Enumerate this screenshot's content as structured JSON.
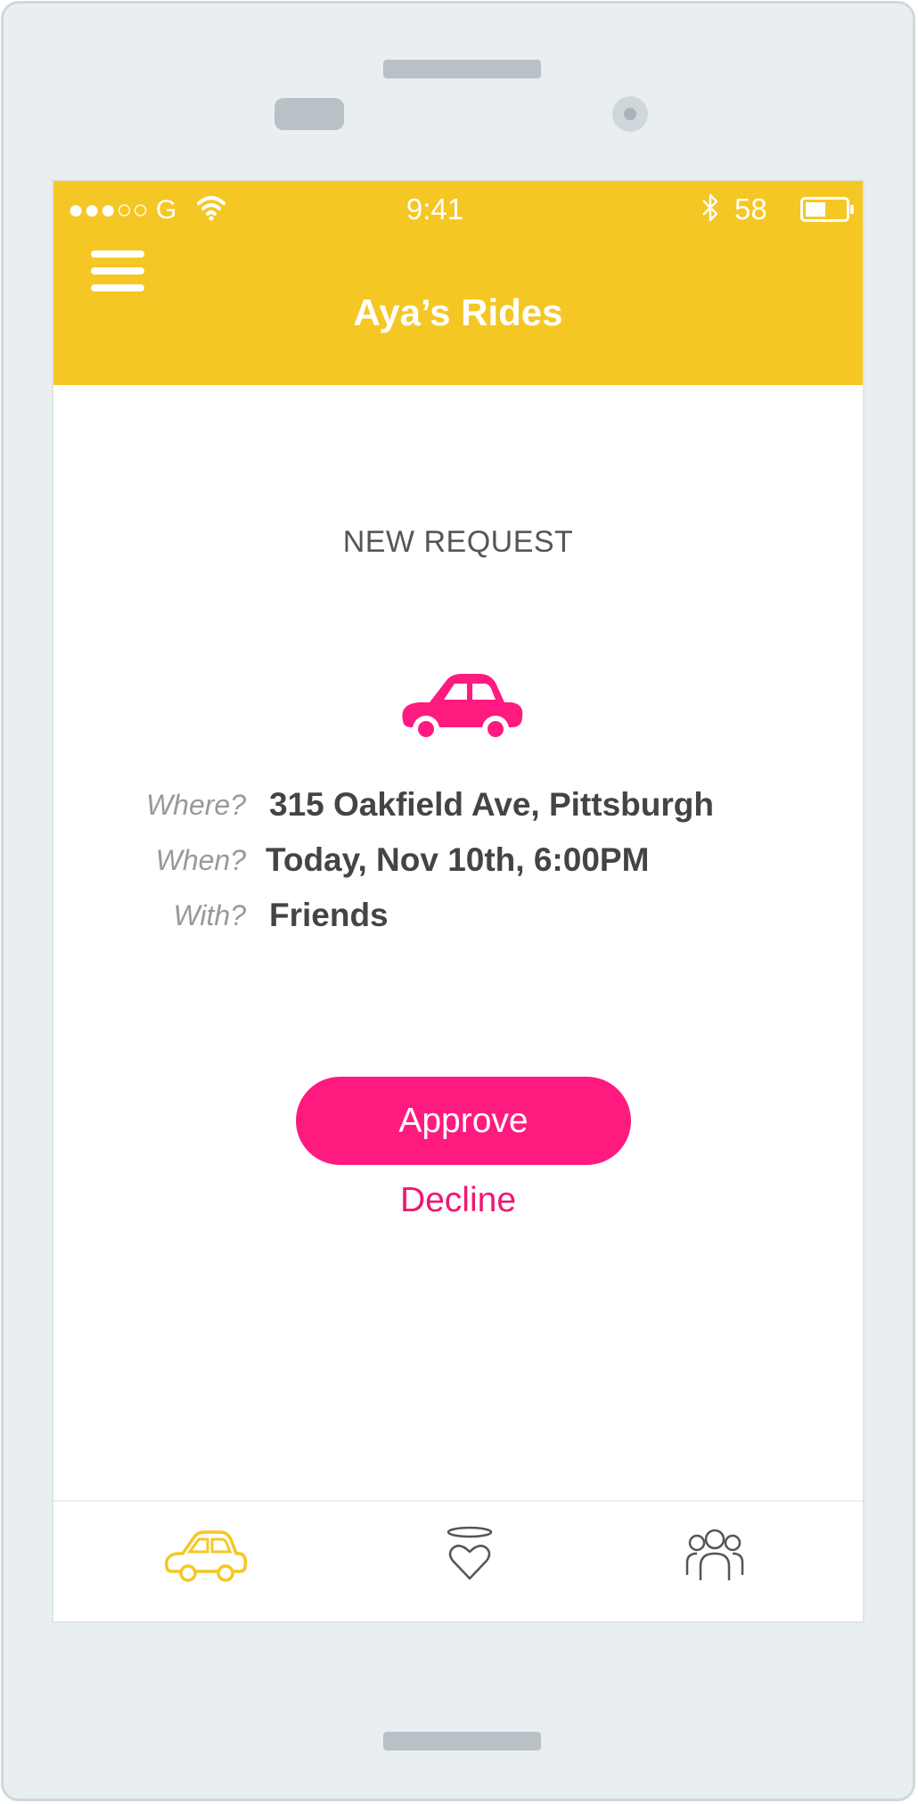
{
  "colors": {
    "accent": "#f5c724",
    "primary_pink": "#ff1a7f",
    "decline_pink": "#f01672",
    "text_dark": "#444444",
    "label_gray": "#999999",
    "tab_active": "#f5c724",
    "tab_inactive": "#555555"
  },
  "status_bar": {
    "signal": "●●●○○ G",
    "wifi_icon": "wifi-icon",
    "time": "9:41",
    "bluetooth_icon": "bluetooth-icon",
    "battery_percent": "58",
    "battery_icon": "battery-icon"
  },
  "header": {
    "menu_icon": "hamburger-menu-icon",
    "title": "Aya’s Rides"
  },
  "request": {
    "section_label": "NEW REQUEST",
    "hero_icon": "car-icon",
    "fields": [
      {
        "label": "Where?",
        "value": "315 Oakfield Ave, Pittsburgh"
      },
      {
        "label": "When?",
        "value": "Today, Nov 10th, 6:00PM"
      },
      {
        "label": "With?",
        "value": "Friends"
      }
    ],
    "approve_label": "Approve",
    "decline_label": "Decline"
  },
  "tab_bar": {
    "tabs": [
      {
        "icon": "car-outline-icon",
        "active": true
      },
      {
        "icon": "halo-heart-icon",
        "active": false
      },
      {
        "icon": "people-group-icon",
        "active": false
      }
    ]
  }
}
